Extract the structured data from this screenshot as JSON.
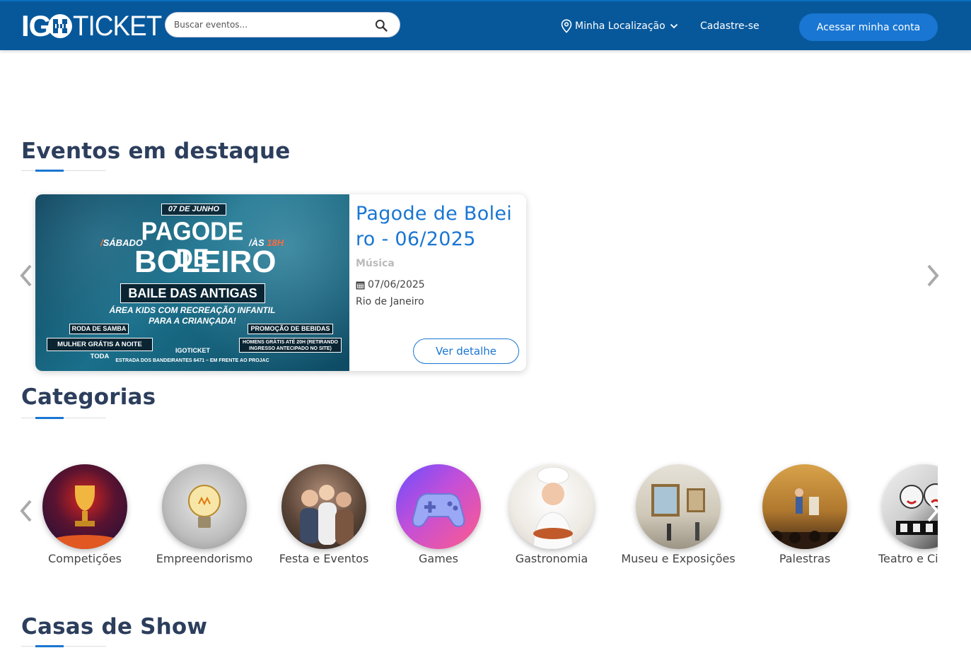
{
  "header": {
    "logo_left": "IG",
    "logo_right": "TICKET",
    "search_placeholder": "Buscar eventos...",
    "location_label": "Minha Localização",
    "signup_label": "Cadastre-se",
    "account_label": "Acessar minha conta"
  },
  "featured": {
    "title": "Eventos em destaque",
    "event": {
      "name": "Pagode de Boleiro - 06/2025",
      "category": "Música",
      "date": "07/06/2025",
      "city": "Rio de Janeiro",
      "detail_label": "Ver detalhe",
      "poster": {
        "date": "07 DE JUNHO",
        "day_prefix": "/",
        "day": "SÁBADO",
        "time_prefix": "/ÀS ",
        "time": "18H",
        "line1": "PAGODE DE",
        "line2": "BOLEIRO",
        "subtitle": "BAILE DAS ANTIGAS",
        "kids": "ÁREA KIDS COM RECREAÇÃO INFANTIL PARA A CRIANÇADA!",
        "roda": "RODA DE SAMBA",
        "promo": "PROMOÇÃO DE BEBIDAS",
        "mulher": "MULHER GRÁTIS A NOITE TODA",
        "homens": "HOMENS GRÁTIS ATÉ 20H (RETIRANDO INGRESSO ANTECIPADO NO SITE)",
        "brand": "IGOTICKET",
        "address": "ESTRADA DOS BANDEIRANTES 6471 – EM FRENTE AO PROJAC"
      }
    }
  },
  "categories": {
    "title": "Categorias",
    "items": [
      {
        "label": "Competições",
        "color1": "#d7261e",
        "color2": "#2a1446"
      },
      {
        "label": "Empreendorismo",
        "color1": "#cfcfcf",
        "color2": "#8a8a8a"
      },
      {
        "label": "Festa e Eventos",
        "color1": "#8a6a5a",
        "color2": "#2a2320"
      },
      {
        "label": "Games",
        "color1": "#ff4fa3",
        "color2": "#6a4dff"
      },
      {
        "label": "Gastronomia",
        "color1": "#f4f1ec",
        "color2": "#c49a6c"
      },
      {
        "label": "Museu e Exposições",
        "color1": "#d9d4c8",
        "color2": "#8c8474"
      },
      {
        "label": "Palestras",
        "color1": "#d8a24a",
        "color2": "#3a2414"
      },
      {
        "label": "Teatro e Cinema",
        "color1": "#e8e8e8",
        "color2": "#111111"
      }
    ]
  },
  "shows": {
    "title": "Casas de Show"
  }
}
